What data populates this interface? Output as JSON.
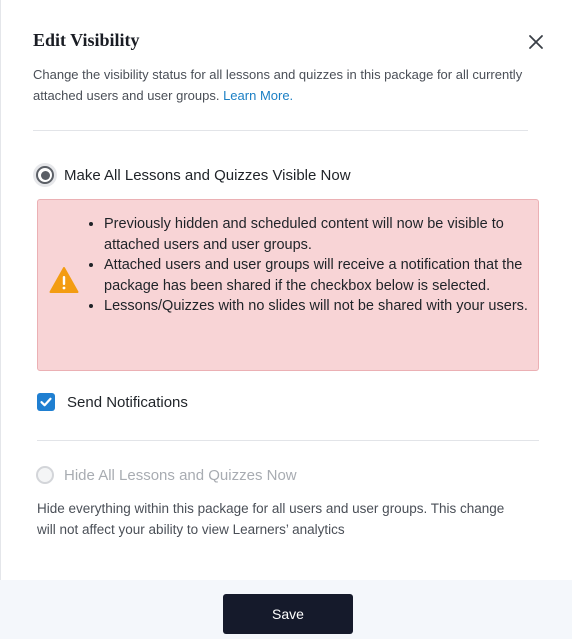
{
  "dialog": {
    "title": "Edit Visibility",
    "description": "Change the visibility status for all lessons and quizzes in this package for all currently attached users and user groups.",
    "learn_more": "Learn More.",
    "close_icon": "close-icon"
  },
  "options": {
    "visible": {
      "label": "Make All Lessons and Quizzes Visible Now",
      "selected": true,
      "warning_icon": "warning-triangle-icon",
      "warnings": [
        "Previously hidden and scheduled content will now be visible to attached users and user groups.",
        "Attached users and user groups will receive a notification that the package has been shared if the checkbox below is selected.",
        "Lessons/Quizzes with no slides will not be shared with your users."
      ]
    },
    "notifications": {
      "label": "Send Notifications",
      "checked": true
    },
    "hide": {
      "label": "Hide All Lessons and Quizzes Now",
      "selected": false,
      "description": "Hide everything within this package for all users and user groups. This change will not affect your ability to view Learners’ analytics"
    }
  },
  "footer": {
    "save_label": "Save"
  },
  "colors": {
    "accent": "#1b7fc4",
    "checkbox": "#1f7fd1",
    "warning_bg": "#f8d4d6",
    "warning_icon": "#f39c12",
    "save_button": "#151a2b"
  }
}
